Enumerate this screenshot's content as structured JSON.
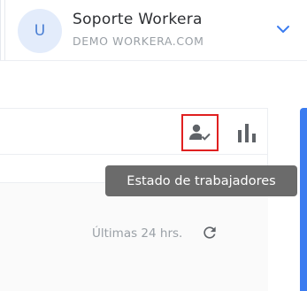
{
  "account": {
    "avatar_initial": "U",
    "name": "Soporte Workera",
    "domain": "DEMO WORKERA.COM"
  },
  "toolbar": {
    "worker_status_tooltip": "Estado de trabajadores"
  },
  "panel": {
    "range_label": "Últimas 24 hrs."
  },
  "colors": {
    "accent": "#3b7cf0",
    "highlight_border": "#e02020",
    "tooltip_bg": "#6b6b6b",
    "avatar_bg": "#e3ecfb",
    "avatar_text": "#4a7fd4"
  },
  "icons": {
    "chevron": "chevron-down-icon",
    "worker_status": "person-check-icon",
    "stats": "bar-chart-icon",
    "refresh": "refresh-icon"
  }
}
